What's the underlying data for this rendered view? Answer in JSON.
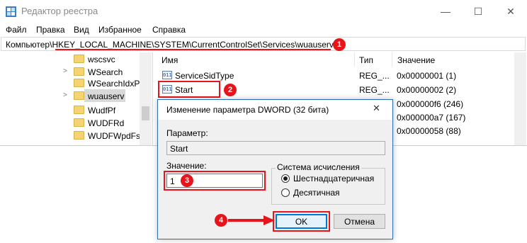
{
  "window": {
    "title": "Редактор реестра",
    "controls": {
      "minimize": "—",
      "maximize": "☐",
      "close": "✕"
    }
  },
  "menu": [
    "Файл",
    "Правка",
    "Вид",
    "Избранное",
    "Справка"
  ],
  "address": {
    "prefix": "Компьютер\\",
    "path": "HKEY_LOCAL_MACHINE\\SYSTEM\\CurrentControlSet\\Services\\wuauserv"
  },
  "tree": {
    "items": [
      "wscsvc",
      "WSearch",
      "WSearchIdxPi",
      "wuauserv",
      "WudfPf",
      "WUDFRd",
      "WUDFWpdFs"
    ],
    "selected": "wuauserv"
  },
  "list": {
    "columns": {
      "name": "Имя",
      "type": "Тип",
      "value": "Значение"
    },
    "rows": [
      {
        "icon": "dword-icon",
        "name": "ServiceSidType",
        "type": "REG_...",
        "value": "0x00000001 (1)"
      },
      {
        "icon": "dword-icon",
        "name": "Start",
        "type": "REG_...",
        "value": "0x00000002 (2)"
      },
      {
        "icon": "dword-icon",
        "name": "",
        "type": "",
        "value": "0x000000f6 (246)"
      },
      {
        "icon": "dword-icon",
        "name": "",
        "type": "",
        "value": "0x000000a7 (167)"
      },
      {
        "icon": "dword-icon",
        "name": "",
        "type": "",
        "value": "0x00000058 (88)"
      }
    ]
  },
  "dialog": {
    "title": "Изменение параметра DWORD (32 бита)",
    "close": "✕",
    "param_label": "Параметр:",
    "param_value": "Start",
    "value_label": "Значение:",
    "value": "1",
    "radix_title": "Система исчисления",
    "radix_options": [
      {
        "label": "Шестнадцатеричная",
        "selected": true
      },
      {
        "label": "Десятичная",
        "selected": false
      }
    ],
    "ok": "OK",
    "cancel": "Отмена"
  },
  "annotations": [
    "1",
    "2",
    "3",
    "4"
  ],
  "colors": {
    "annotation_red": "#e8141b",
    "accent": "#0078d7"
  }
}
